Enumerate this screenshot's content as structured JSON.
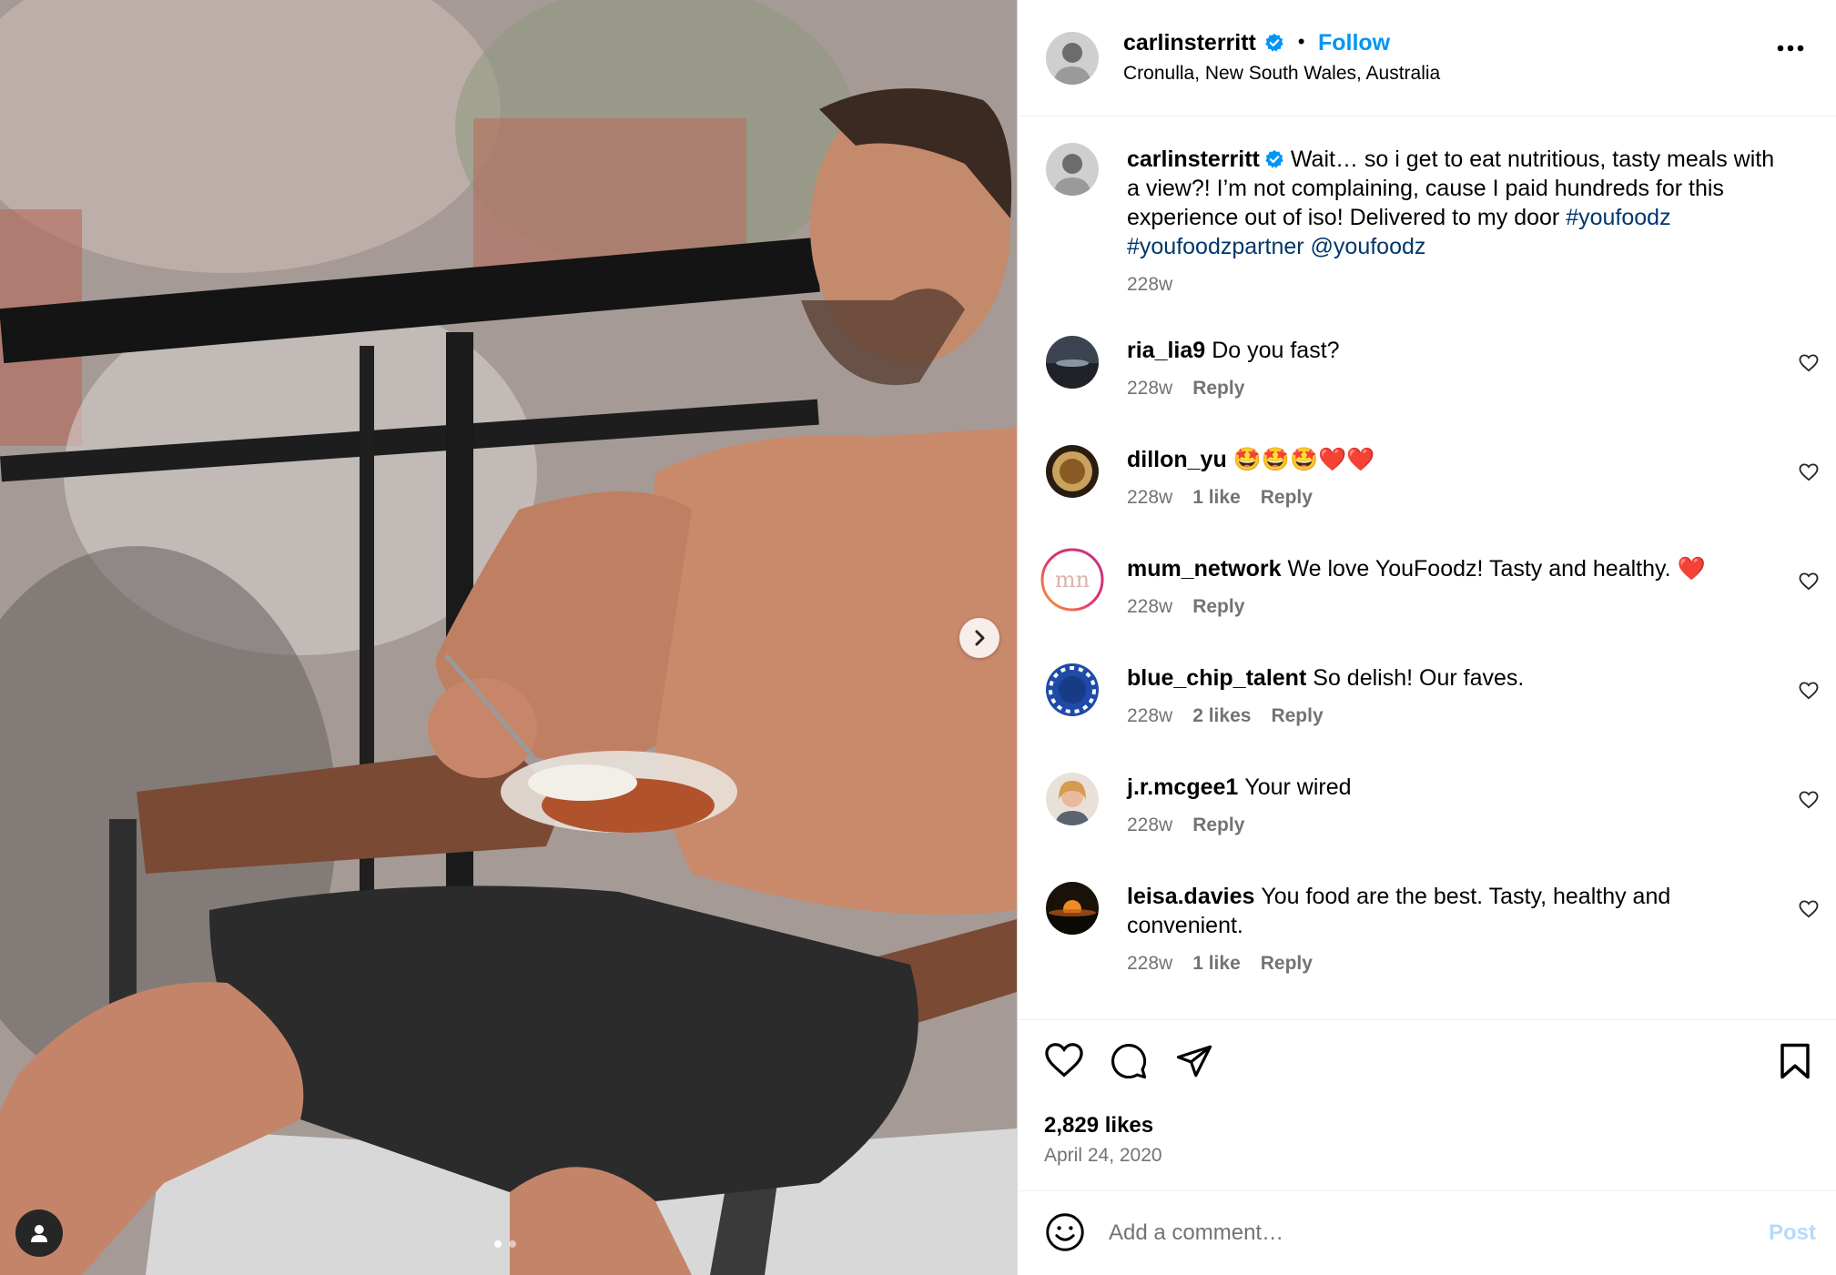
{
  "post": {
    "author": "carlinsterritt",
    "follow_label": "Follow",
    "separator": "•",
    "location": "Cronulla, New South Wales, Australia",
    "caption_text": "Wait… so i get to eat nutritious, tasty meals with a view?! I’m not complaining, cause I paid hundreds for this experience out of iso! Delivered to my door",
    "caption_tags": [
      "#youfoodz",
      "#youfoodzpartner",
      "@youfoodz"
    ],
    "caption_age": "228w",
    "likes": "2,829 likes",
    "date": "April 24, 2020"
  },
  "comments": [
    {
      "user": "ria_lia9",
      "text": "Do you fast?",
      "age": "228w",
      "likes": "",
      "reply": "Reply"
    },
    {
      "user": "dillon_yu",
      "text": "🤩🤩🤩❤️❤️",
      "age": "228w",
      "likes": "1 like",
      "reply": "Reply"
    },
    {
      "user": "mum_network",
      "text": "We love YouFoodz! Tasty and healthy. ❤️",
      "age": "228w",
      "likes": "",
      "reply": "Reply"
    },
    {
      "user": "blue_chip_talent",
      "text": "So delish! Our faves.",
      "age": "228w",
      "likes": "2 likes",
      "reply": "Reply"
    },
    {
      "user": "j.r.mcgee1",
      "text": "Your wired",
      "age": "228w",
      "likes": "",
      "reply": "Reply"
    },
    {
      "user": "leisa.davies",
      "text": "You food are the best. Tasty, healthy and convenient.",
      "age": "228w",
      "likes": "1 like",
      "reply": "Reply"
    }
  ],
  "add_comment": {
    "placeholder": "Add a comment…",
    "post_label": "Post"
  },
  "carousel": {
    "total": 2,
    "current": 1
  },
  "colors": {
    "accent": "#0095f6",
    "link": "#00376b",
    "muted": "#737373",
    "verified": "#0095f6"
  },
  "icons": [
    "verified-badge-icon",
    "more-options-icon",
    "heart-icon",
    "comment-icon",
    "share-icon",
    "bookmark-icon",
    "emoji-icon",
    "chevron-right-icon",
    "user-tag-icon"
  ]
}
